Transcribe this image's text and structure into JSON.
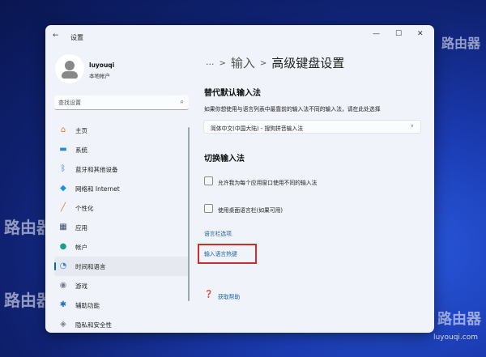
{
  "window": {
    "title": "设置",
    "back": "←",
    "minimize": "—",
    "maximize": "☐",
    "close": "✕"
  },
  "user": {
    "name": "luyouqi",
    "type": "本地帐户"
  },
  "search": {
    "placeholder": "查找设置"
  },
  "nav": [
    {
      "label": "主页",
      "icon": "home-icon",
      "glyph": "⌂",
      "color": "#e07a30"
    },
    {
      "label": "系统",
      "icon": "system-icon",
      "glyph": "▬",
      "color": "#2a8ad0"
    },
    {
      "label": "蓝牙和其他设备",
      "icon": "bluetooth-icon",
      "glyph": "ᛒ",
      "color": "#1a6fd0"
    },
    {
      "label": "网络和 Internet",
      "icon": "wifi-icon",
      "glyph": "◆",
      "color": "#1a8ee0"
    },
    {
      "label": "个性化",
      "icon": "brush-icon",
      "glyph": "╱",
      "color": "#e07a30"
    },
    {
      "label": "应用",
      "icon": "apps-icon",
      "glyph": "▦",
      "color": "#3a4a6a"
    },
    {
      "label": "帐户",
      "icon": "account-icon",
      "glyph": "●",
      "color": "#1aa08a"
    },
    {
      "label": "时间和语言",
      "icon": "time-language-icon",
      "glyph": "◔",
      "color": "#2a8ad0"
    },
    {
      "label": "游戏",
      "icon": "gaming-icon",
      "glyph": "◉",
      "color": "#7a8090"
    },
    {
      "label": "辅助功能",
      "icon": "accessibility-icon",
      "glyph": "✱",
      "color": "#1a6fd0"
    },
    {
      "label": "隐私和安全性",
      "icon": "shield-icon",
      "glyph": "◈",
      "color": "#7a8090"
    }
  ],
  "breadcrumb": {
    "more": "···",
    "parent": "输入",
    "current": "高级键盘设置"
  },
  "section1": {
    "title": "替代默认输入法",
    "description": "如果你想使用与语言列表中最靠前的输入法不同的输入法，请在此处选择",
    "dropdown": "简体中文(中国大陆) - 搜狗拼音输入法"
  },
  "section2": {
    "title": "切换输入法",
    "checkbox1": "允许我为每个应用窗口使用不同的输入法",
    "checkbox2": "使用桌面语言栏(如果可用)",
    "link1": "语言栏选项",
    "link2": "输入语言热键"
  },
  "help": "获取帮助",
  "watermark": {
    "text": "路由器",
    "url": "luyouqi.com"
  }
}
